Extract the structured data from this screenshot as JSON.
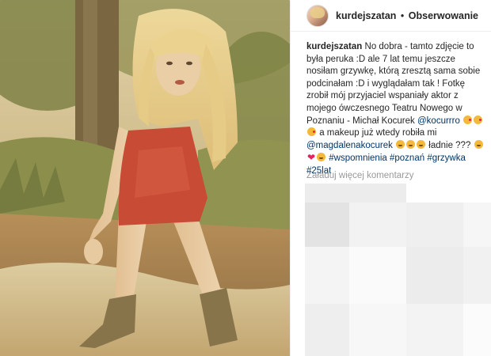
{
  "post": {
    "username": "kurdejszatan",
    "separator": "•",
    "follow_label": "Obserwowanie"
  },
  "caption": {
    "username": "kurdejszatan",
    "text_1": "No dobra - tamto zdjęcie to była peruka :D ale 7 lat temu jeszcze nosiłam grzywkę, którą zresztą sama sobie podcinałam :D i wyglądałam tak ! Fotkę zrobił mój przyjaciel wspaniały aktor z mojego ówczesnego Teatru Nowego w Poznaniu - Michał Kocurek",
    "mention_1": "@kocurrro",
    "text_2": "a makeup już wtedy robiła mi",
    "mention_2": "@magdalenakocurek",
    "text_3": "ładnie ???",
    "hashtags": [
      "#wspomnienia",
      "#poznań",
      "#grzywka",
      "#25lat"
    ]
  },
  "comments": {
    "load_more_label": "Załaduj więcej komentarzy"
  },
  "colors": {
    "link": "#003569",
    "muted": "#999999",
    "text": "#262626",
    "photo_tone": "#c4b07c"
  },
  "icons": [
    "avatar",
    "kiss-emoji",
    "grin-emoji",
    "heart-emoji"
  ]
}
